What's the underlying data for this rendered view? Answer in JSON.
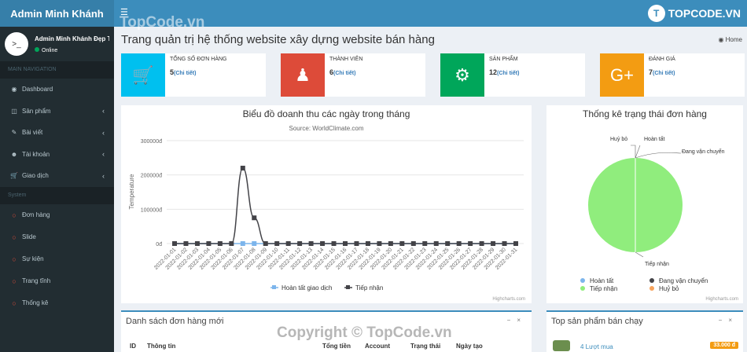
{
  "sidebar": {
    "logo": "Admin Minh Khánh",
    "user_name": "Admin Minh Khánh Đẹp Trai",
    "status": "Online",
    "main_nav_header": "MAIN NAVIGATION",
    "main_items": [
      {
        "label": "Dashboard",
        "icon": "dashboard-icon",
        "chev": ""
      },
      {
        "label": "Sản phẩm",
        "icon": "database-icon",
        "chev": "‹"
      },
      {
        "label": "Bài viết",
        "icon": "edit-icon",
        "chev": "‹"
      },
      {
        "label": "Tài khoản",
        "icon": "user-icon",
        "chev": "‹"
      },
      {
        "label": "Giao dịch",
        "icon": "cart-icon",
        "chev": "‹"
      }
    ],
    "system_header": "System",
    "system_items": [
      "Đơn hàng",
      "Slide",
      "Sự kiện",
      "Trang tĩnh",
      "Thống kê"
    ]
  },
  "header": {
    "title": "Trang quản trị hệ thống website xây dựng website bán hàng",
    "breadcrumb": "Home"
  },
  "info_boxes": [
    {
      "label": "TỔNG SỐ ĐƠN HÀNG",
      "count": "5",
      "link": "(Chi tiết)",
      "color": "#00c0ef",
      "icon": "cart-icon"
    },
    {
      "label": "THÀNH VIÊN",
      "count": "6",
      "link": "(Chi tiết)",
      "color": "#dd4b39",
      "icon": "users-icon"
    },
    {
      "label": "SẢN PHẨM",
      "count": "12",
      "link": "(Chi tiết)",
      "color": "#00a65a",
      "icon": "gear-icon"
    },
    {
      "label": "ĐÁNH GIÁ",
      "count": "7",
      "link": "(Chi tiết)",
      "color": "#f39c12",
      "icon": "google-plus-icon"
    }
  ],
  "chart_data": [
    {
      "type": "line",
      "title": "Biểu đồ doanh thu các ngày trong tháng",
      "subtitle": "Source: WorldClimate.com",
      "ylabel": "Temperature",
      "ylim": [
        0,
        300000
      ],
      "yticks": [
        "0đ",
        "100000đ",
        "200000đ",
        "300000đ"
      ],
      "categories": [
        "2022-01-01",
        "2022-01-02",
        "2022-01-03",
        "2022-01-04",
        "2022-01-05",
        "2022-01-06",
        "2022-01-07",
        "2022-01-08",
        "2022-01-09",
        "2022-01-10",
        "2022-01-11",
        "2022-01-12",
        "2022-01-13",
        "2022-01-14",
        "2022-01-15",
        "2022-01-16",
        "2022-01-17",
        "2022-01-18",
        "2022-01-19",
        "2022-01-20",
        "2022-01-21",
        "2022-01-22",
        "2022-01-23",
        "2022-01-24",
        "2022-01-25",
        "2022-01-26",
        "2022-01-27",
        "2022-01-28",
        "2022-01-29",
        "2022-01-30",
        "2022-01-31"
      ],
      "series": [
        {
          "name": "Hoàn tất giao dịch",
          "color": "#7cb5ec",
          "values": [
            0,
            0,
            0,
            0,
            0,
            0,
            0,
            0,
            0,
            0,
            0,
            0,
            0,
            0,
            0,
            0,
            0,
            0,
            0,
            0,
            0,
            0,
            0,
            0,
            0,
            0,
            0,
            0,
            0,
            0,
            0
          ]
        },
        {
          "name": "Tiếp nhận",
          "color": "#434348",
          "values": [
            0,
            0,
            0,
            0,
            0,
            0,
            220000,
            75000,
            0,
            0,
            0,
            0,
            0,
            0,
            0,
            0,
            0,
            0,
            0,
            0,
            0,
            0,
            0,
            0,
            0,
            0,
            0,
            0,
            0,
            0,
            0
          ]
        }
      ],
      "credits": "Highcharts.com"
    },
    {
      "type": "pie",
      "title": "Thống kê trạng thái đơn hàng",
      "slices": [
        {
          "name": "Hoàn tất",
          "value": 0,
          "color": "#7cb5ec"
        },
        {
          "name": "Đang vận chuyển",
          "value": 0,
          "color": "#434348"
        },
        {
          "name": "Tiếp nhận",
          "value": 100,
          "color": "#90ed7d"
        },
        {
          "name": "Huỷ bỏ",
          "value": 0,
          "color": "#f7a35c"
        }
      ],
      "credits": "Highcharts.com"
    }
  ],
  "orders_box": {
    "title": "Danh sách đơn hàng mới",
    "columns": [
      "ID",
      "Thông tin",
      "Tổng tiền",
      "Account",
      "Trạng thái",
      "Ngày tạo"
    ]
  },
  "products_box": {
    "title": "Top sản phẩm bán chạy",
    "first_item": "4 Lượt mua",
    "first_price": "33.000 đ"
  },
  "watermarks": {
    "top": "TopCode.vn",
    "bottom": "Copyright © TopCode.vn",
    "brand": "TOPCODE.VN"
  }
}
